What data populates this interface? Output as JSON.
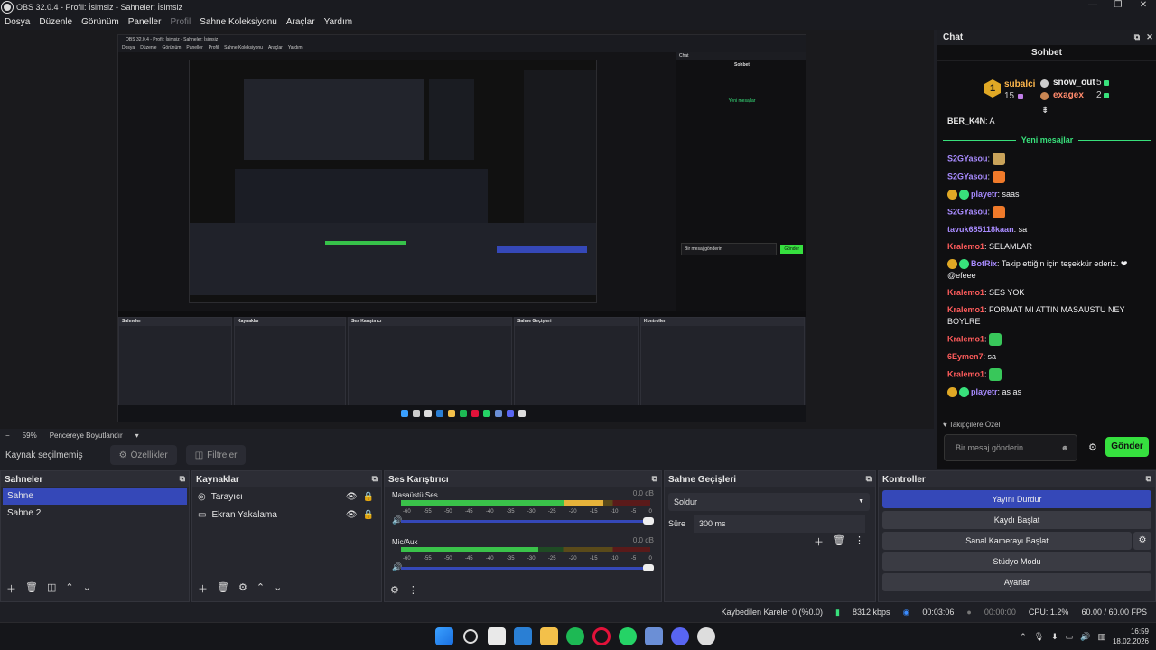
{
  "window": {
    "title": "OBS 32.0.4 - Profil: İsimsiz - Sahneler: İsimsiz",
    "min": "—",
    "max": "❐",
    "close": "✕"
  },
  "menu": [
    "Dosya",
    "Düzenle",
    "Görünüm",
    "Paneller",
    "Profil",
    "Sahne Koleksiyonu",
    "Araçlar",
    "Yardım"
  ],
  "inner": {
    "title": "OBS 32.0.4 - Profil: İsimsiz - Sahneler: İsimsiz",
    "menu": [
      "Dosya",
      "Düzenle",
      "Görünüm",
      "Paneller",
      "Profil",
      "Sahne Koleksiyonu",
      "Araçlar",
      "Yardım"
    ],
    "chat_title": "Chat",
    "chat_head": "Sohbet",
    "new_messages": "Yeni mesajlar",
    "docks": [
      "Sahneler",
      "Kaynaklar",
      "Ses Karıştırıcı",
      "Sahne Geçişleri",
      "Kontroller"
    ],
    "chat_input": "Bir mesaj gönderin",
    "chat_send": "Gönder"
  },
  "preview_status": {
    "zoom": "59%",
    "fit": "Pencereye Boyutlandır"
  },
  "source_bar": {
    "none_selected": "Kaynak seçilmemiş",
    "properties": "Özellikler",
    "filters": "Filtreler"
  },
  "chat": {
    "dock_title": "Chat",
    "header": "Sohbet",
    "leaderboard": [
      {
        "rank": "1",
        "name": "subalci",
        "count": "15",
        "gem": "#c07ee8"
      },
      {
        "name": "snow_out",
        "count": "5",
        "gem": "#38e07b"
      },
      {
        "name": "exagex",
        "count": "2",
        "gem": "#38e07b"
      }
    ],
    "partial_line": {
      "user": "BER_K4N",
      "text": ": A"
    },
    "new_messages": "Yeni mesajlar",
    "messages": [
      {
        "user": "S2GYasou",
        "color": "#a88bff",
        "text": ":",
        "emote": "#c9a35a"
      },
      {
        "user": "S2GYasou",
        "color": "#a88bff",
        "text": ":",
        "emote": "#f07a2a"
      },
      {
        "user": "playetr",
        "color": "#a88bff",
        "text": ": saas",
        "badges": true
      },
      {
        "user": "S2GYasou",
        "color": "#a88bff",
        "text": ":",
        "emote": "#f07a2a"
      },
      {
        "user": "tavuk685118kaan",
        "color": "#a88bff",
        "text": ": sa"
      },
      {
        "user": "Kralemo1",
        "color": "#ff5c5c",
        "text": ": SELAMLAR"
      },
      {
        "user": "BotRix",
        "color": "#a88bff",
        "text": ": Takip ettiğin için teşekkür ederiz. ❤ @efeee",
        "badges": true
      },
      {
        "user": "Kralemo1",
        "color": "#ff5c5c",
        "text": ": SES YOK"
      },
      {
        "user": "Kralemo1",
        "color": "#ff5c5c",
        "text": ": FORMAT MI ATTIN MASAUSTU NEY BOYLRE"
      },
      {
        "user": "Kralemo1",
        "color": "#ff5c5c",
        "text": ":",
        "emote": "#38c75a"
      },
      {
        "user": "6Eymen7",
        "color": "#ff5c5c",
        "text": ": sa"
      },
      {
        "user": "Kralemo1",
        "color": "#ff5c5c",
        "text": ":",
        "emote": "#38c75a"
      },
      {
        "user": "playetr",
        "color": "#a88bff",
        "text": ": as as",
        "badges": true
      }
    ],
    "followers_only": "Takipçilere Özel",
    "input_placeholder": "Bir mesaj gönderin",
    "send": "Gönder"
  },
  "docks": {
    "scenes": {
      "title": "Sahneler",
      "items": [
        "Sahne",
        "Sahne 2"
      ]
    },
    "sources": {
      "title": "Kaynaklar",
      "items": [
        "Tarayıcı",
        "Ekran Yakalama"
      ]
    },
    "mixer": {
      "title": "Ses Karıştırıcı",
      "channels": [
        {
          "name": "Masaüstü Ses",
          "db": "0.0 dB",
          "level": 0.81
        },
        {
          "name": "Mic/Aux",
          "db": "0.0 dB",
          "level": 0.55
        }
      ],
      "ticks": [
        "-60",
        "-55",
        "-50",
        "-45",
        "-40",
        "-35",
        "-30",
        "-25",
        "-20",
        "-15",
        "-10",
        "-5",
        "0"
      ]
    },
    "transitions": {
      "title": "Sahne Geçişleri",
      "type": "Soldur",
      "duration_label": "Süre",
      "duration": "300 ms"
    },
    "controls": {
      "title": "Kontroller",
      "buttons": [
        "Yayını Durdur",
        "Kaydı Başlat",
        "Sanal Kamerayı Başlat",
        "Stüdyo Modu",
        "Ayarlar"
      ]
    }
  },
  "status": {
    "dropped": "Kaybedilen Kareler 0 (%0.0)",
    "bitrate": "8312 kbps",
    "stream_time": "00:03:06",
    "rec_time": "00:00:00",
    "cpu": "CPU: 1.2%",
    "fps": "60.00 / 60.00 FPS"
  },
  "taskbar": {
    "time": "16:59",
    "date": "18.02.2026"
  }
}
